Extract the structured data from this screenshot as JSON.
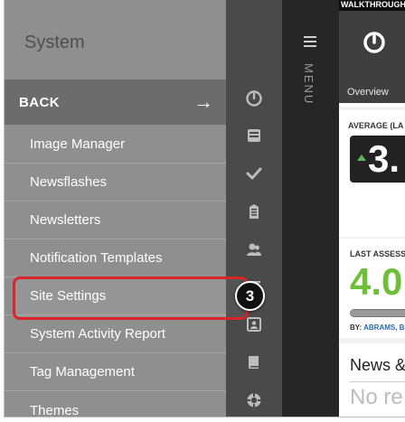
{
  "sidebar": {
    "title": "System",
    "back_label": "BACK",
    "back_icon": "arrow-right-icon",
    "items": [
      {
        "label": "Image Manager"
      },
      {
        "label": "Newsflashes"
      },
      {
        "label": "Newsletters"
      },
      {
        "label": "Notification Templates"
      },
      {
        "label": "Site Settings"
      },
      {
        "label": "System Activity Report"
      },
      {
        "label": "Tag Management"
      },
      {
        "label": "Themes"
      }
    ]
  },
  "icon_rail": {
    "icons": [
      "dashboard-icon",
      "inbox-icon",
      "checkmark-icon",
      "building-icon",
      "people-icon",
      "list-icon",
      "id-card-icon",
      "book-icon",
      "lifebuoy-icon"
    ]
  },
  "menu_strip": {
    "label": "MENU",
    "icon": "hamburger-icon"
  },
  "main": {
    "walkthrough_label": "WALKTHROUGH",
    "tab_label": "Overview",
    "average_label": "AVERAGE (LA",
    "average_value": "3.",
    "last_label": "LAST ASSESS",
    "last_value": "4.0",
    "by_prefix": "BY:",
    "by_name": "ABRAMS, BI",
    "progress_fraction": 1.0,
    "news_title": "News &",
    "news_empty": "No re"
  },
  "callout": {
    "step_number": "3",
    "color": "#d9242a"
  },
  "colors": {
    "sidebar_bg": "#8f8f8f",
    "back_row_bg": "#6c6c6c",
    "icon_rail_bg": "#4a4a4a",
    "menu_strip_bg": "#262626",
    "accent_green": "#6fbf3a"
  }
}
